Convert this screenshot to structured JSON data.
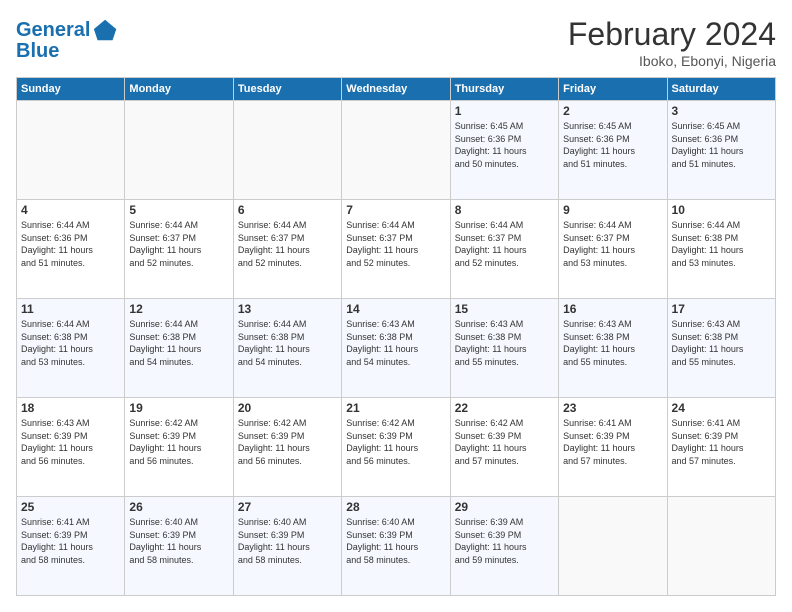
{
  "logo": {
    "line1": "General",
    "line2": "Blue"
  },
  "title": "February 2024",
  "subtitle": "Iboko, Ebonyi, Nigeria",
  "headers": [
    "Sunday",
    "Monday",
    "Tuesday",
    "Wednesday",
    "Thursday",
    "Friday",
    "Saturday"
  ],
  "weeks": [
    [
      {
        "day": "",
        "info": ""
      },
      {
        "day": "",
        "info": ""
      },
      {
        "day": "",
        "info": ""
      },
      {
        "day": "",
        "info": ""
      },
      {
        "day": "1",
        "info": "Sunrise: 6:45 AM\nSunset: 6:36 PM\nDaylight: 11 hours\nand 50 minutes."
      },
      {
        "day": "2",
        "info": "Sunrise: 6:45 AM\nSunset: 6:36 PM\nDaylight: 11 hours\nand 51 minutes."
      },
      {
        "day": "3",
        "info": "Sunrise: 6:45 AM\nSunset: 6:36 PM\nDaylight: 11 hours\nand 51 minutes."
      }
    ],
    [
      {
        "day": "4",
        "info": "Sunrise: 6:44 AM\nSunset: 6:36 PM\nDaylight: 11 hours\nand 51 minutes."
      },
      {
        "day": "5",
        "info": "Sunrise: 6:44 AM\nSunset: 6:37 PM\nDaylight: 11 hours\nand 52 minutes."
      },
      {
        "day": "6",
        "info": "Sunrise: 6:44 AM\nSunset: 6:37 PM\nDaylight: 11 hours\nand 52 minutes."
      },
      {
        "day": "7",
        "info": "Sunrise: 6:44 AM\nSunset: 6:37 PM\nDaylight: 11 hours\nand 52 minutes."
      },
      {
        "day": "8",
        "info": "Sunrise: 6:44 AM\nSunset: 6:37 PM\nDaylight: 11 hours\nand 52 minutes."
      },
      {
        "day": "9",
        "info": "Sunrise: 6:44 AM\nSunset: 6:37 PM\nDaylight: 11 hours\nand 53 minutes."
      },
      {
        "day": "10",
        "info": "Sunrise: 6:44 AM\nSunset: 6:38 PM\nDaylight: 11 hours\nand 53 minutes."
      }
    ],
    [
      {
        "day": "11",
        "info": "Sunrise: 6:44 AM\nSunset: 6:38 PM\nDaylight: 11 hours\nand 53 minutes."
      },
      {
        "day": "12",
        "info": "Sunrise: 6:44 AM\nSunset: 6:38 PM\nDaylight: 11 hours\nand 54 minutes."
      },
      {
        "day": "13",
        "info": "Sunrise: 6:44 AM\nSunset: 6:38 PM\nDaylight: 11 hours\nand 54 minutes."
      },
      {
        "day": "14",
        "info": "Sunrise: 6:43 AM\nSunset: 6:38 PM\nDaylight: 11 hours\nand 54 minutes."
      },
      {
        "day": "15",
        "info": "Sunrise: 6:43 AM\nSunset: 6:38 PM\nDaylight: 11 hours\nand 55 minutes."
      },
      {
        "day": "16",
        "info": "Sunrise: 6:43 AM\nSunset: 6:38 PM\nDaylight: 11 hours\nand 55 minutes."
      },
      {
        "day": "17",
        "info": "Sunrise: 6:43 AM\nSunset: 6:38 PM\nDaylight: 11 hours\nand 55 minutes."
      }
    ],
    [
      {
        "day": "18",
        "info": "Sunrise: 6:43 AM\nSunset: 6:39 PM\nDaylight: 11 hours\nand 56 minutes."
      },
      {
        "day": "19",
        "info": "Sunrise: 6:42 AM\nSunset: 6:39 PM\nDaylight: 11 hours\nand 56 minutes."
      },
      {
        "day": "20",
        "info": "Sunrise: 6:42 AM\nSunset: 6:39 PM\nDaylight: 11 hours\nand 56 minutes."
      },
      {
        "day": "21",
        "info": "Sunrise: 6:42 AM\nSunset: 6:39 PM\nDaylight: 11 hours\nand 56 minutes."
      },
      {
        "day": "22",
        "info": "Sunrise: 6:42 AM\nSunset: 6:39 PM\nDaylight: 11 hours\nand 57 minutes."
      },
      {
        "day": "23",
        "info": "Sunrise: 6:41 AM\nSunset: 6:39 PM\nDaylight: 11 hours\nand 57 minutes."
      },
      {
        "day": "24",
        "info": "Sunrise: 6:41 AM\nSunset: 6:39 PM\nDaylight: 11 hours\nand 57 minutes."
      }
    ],
    [
      {
        "day": "25",
        "info": "Sunrise: 6:41 AM\nSunset: 6:39 PM\nDaylight: 11 hours\nand 58 minutes."
      },
      {
        "day": "26",
        "info": "Sunrise: 6:40 AM\nSunset: 6:39 PM\nDaylight: 11 hours\nand 58 minutes."
      },
      {
        "day": "27",
        "info": "Sunrise: 6:40 AM\nSunset: 6:39 PM\nDaylight: 11 hours\nand 58 minutes."
      },
      {
        "day": "28",
        "info": "Sunrise: 6:40 AM\nSunset: 6:39 PM\nDaylight: 11 hours\nand 58 minutes."
      },
      {
        "day": "29",
        "info": "Sunrise: 6:39 AM\nSunset: 6:39 PM\nDaylight: 11 hours\nand 59 minutes."
      },
      {
        "day": "",
        "info": ""
      },
      {
        "day": "",
        "info": ""
      }
    ]
  ]
}
